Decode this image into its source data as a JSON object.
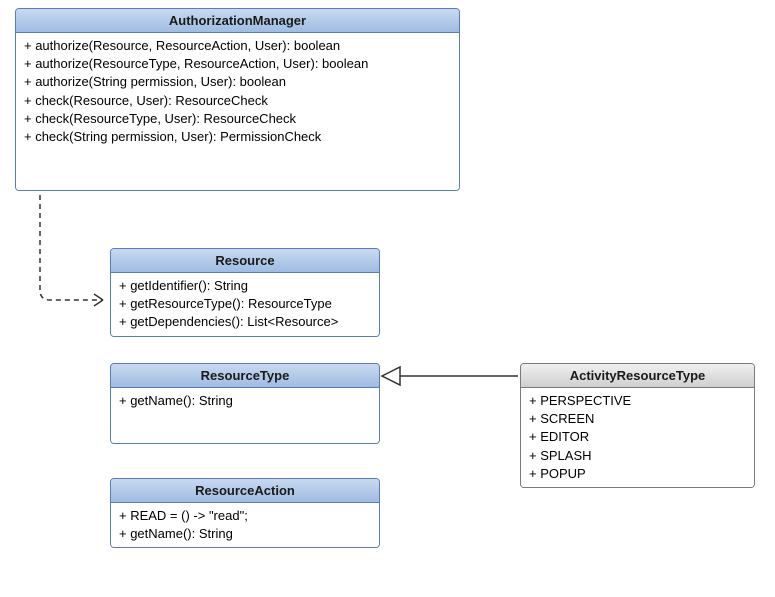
{
  "classes": {
    "authManager": {
      "name": "AuthorizationManager",
      "members": [
        "+ authorize(Resource, ResourceAction, User): boolean",
        "+ authorize(ResourceType, ResourceAction, User): boolean",
        "+ authorize(String permission, User): boolean",
        "+ check(Resource, User): ResourceCheck",
        "+ check(ResourceType, User): ResourceCheck",
        "+ check(String permission, User): PermissionCheck"
      ]
    },
    "resource": {
      "name": "Resource",
      "members": [
        "+ getIdentifier(): String",
        "+ getResourceType(): ResourceType",
        "+ getDependencies(): List<Resource>"
      ]
    },
    "resourceType": {
      "name": "ResourceType",
      "members": [
        "+ getName(): String"
      ]
    },
    "resourceAction": {
      "name": "ResourceAction",
      "members": [
        "+ READ = () -> \"read\";",
        "+ getName(): String"
      ]
    },
    "activityResourceType": {
      "name": "ActivityResourceType",
      "members": [
        "+ PERSPECTIVE",
        "+ SCREEN",
        "+ EDITOR",
        "+ SPLASH",
        "+ POPUP"
      ]
    }
  },
  "chart_data": {
    "type": "table",
    "description": "UML class diagram",
    "classes": [
      {
        "name": "AuthorizationManager",
        "stereotype": "class",
        "members": [
          "+ authorize(Resource, ResourceAction, User): boolean",
          "+ authorize(ResourceType, ResourceAction, User): boolean",
          "+ authorize(String permission, User): boolean",
          "+ check(Resource, User): ResourceCheck",
          "+ check(ResourceType, User): ResourceCheck",
          "+ check(String permission, User): PermissionCheck"
        ]
      },
      {
        "name": "Resource",
        "stereotype": "class",
        "members": [
          "+ getIdentifier(): String",
          "+ getResourceType(): ResourceType",
          "+ getDependencies(): List<Resource>"
        ]
      },
      {
        "name": "ResourceType",
        "stereotype": "class",
        "members": [
          "+ getName(): String"
        ]
      },
      {
        "name": "ResourceAction",
        "stereotype": "class",
        "members": [
          "+ READ = () -> \"read\";",
          "+ getName(): String"
        ]
      },
      {
        "name": "ActivityResourceType",
        "stereotype": "class",
        "members": [
          "+ PERSPECTIVE",
          "+ SCREEN",
          "+ EDITOR",
          "+ SPLASH",
          "+ POPUP"
        ]
      }
    ],
    "relationships": [
      {
        "from": "AuthorizationManager",
        "to": "Resource",
        "type": "dependency",
        "style": "dashed-open-arrow"
      },
      {
        "from": "ActivityResourceType",
        "to": "ResourceType",
        "type": "realization/generalization",
        "style": "solid-hollow-triangle"
      }
    ]
  }
}
